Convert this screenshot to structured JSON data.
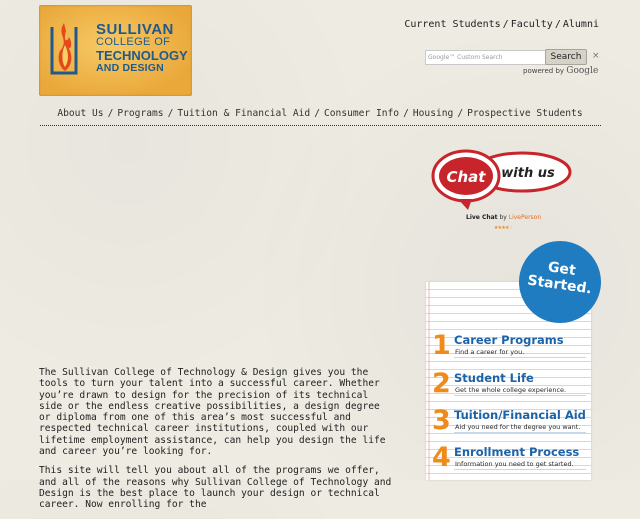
{
  "logo": {
    "line1": "SULLIVAN",
    "line2": "COLLEGE OF",
    "line3": "TECHNOLOGY",
    "line4": "AND DESIGN"
  },
  "top_links": [
    {
      "label": "Current Students"
    },
    {
      "label": "Faculty"
    },
    {
      "label": "Alumni"
    }
  ],
  "top_link_separator": "/",
  "search": {
    "placeholder": "Custom Search",
    "placeholder_brand": "Google",
    "button_label": "Search",
    "clear_glyph": "×",
    "powered_by": "powered by",
    "powered_brand": "Google"
  },
  "nav": {
    "separator": "/",
    "items": [
      {
        "label": "About Us"
      },
      {
        "label": "Programs"
      },
      {
        "label": "Tuition & Financial Aid"
      },
      {
        "label": "Consumer Info"
      },
      {
        "label": "Housing"
      },
      {
        "label": "Prospective Students"
      }
    ]
  },
  "chat": {
    "badge_word1": "Chat",
    "badge_word2": "with us",
    "label_strong": "Live Chat",
    "label_by": " by ",
    "label_vendor": "LivePerson",
    "rating": 4,
    "rating_max": 5
  },
  "get_started": {
    "line1": "Get",
    "line2": "Started.",
    "items": [
      {
        "num": "1",
        "title": "Career Programs",
        "subtitle": "Find a career for you."
      },
      {
        "num": "2",
        "title": "Student Life",
        "subtitle": "Get the whole college experience."
      },
      {
        "num": "3",
        "title": "Tuition/Financial Aid",
        "subtitle": "Aid you need for the degree you want."
      },
      {
        "num": "4",
        "title": "Enrollment Process",
        "subtitle": "Information you need to get started."
      }
    ]
  },
  "intro": {
    "p1": "The Sullivan College of Technology & Design gives you the tools to turn your talent into a successful career. Whether you’re drawn to design for the precision of its technical side or the endless creative possibilities, a design degree or diploma from one of this area’s most successful and respected technical career institutions, coupled with our lifetime employment assistance, can help you design the life and career you’re looking for.",
    "p2": "This site will tell you about all of the programs we offer, and all of the reasons why Sullivan College of Technology and Design is the best place to launch your design or technical career. Now enrolling for the"
  },
  "colors": {
    "background": "#eeebe3",
    "logo_orange": "#f0b54a",
    "logo_blue": "#1f5a8f",
    "accent_blue": "#1f7cc1",
    "accent_orange": "#f08a1a",
    "chat_red": "#c8242b"
  }
}
